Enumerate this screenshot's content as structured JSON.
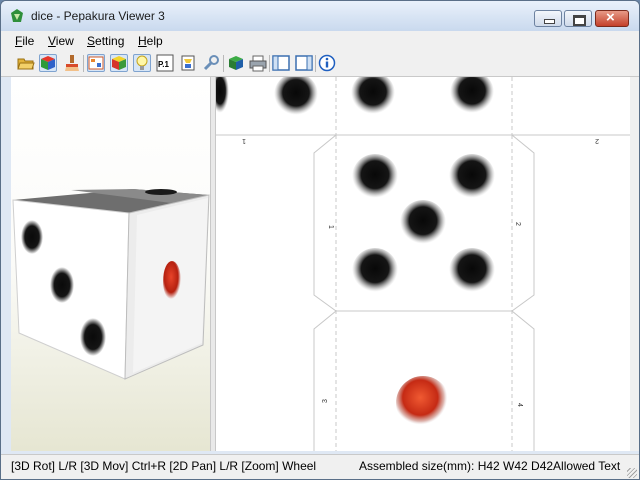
{
  "window": {
    "title": "dice - Pepakura Viewer 3"
  },
  "menu": {
    "file": {
      "mnemonic": "F",
      "rest": "ile"
    },
    "view": {
      "mnemonic": "V",
      "rest": "iew"
    },
    "setting": {
      "mnemonic": "S",
      "rest": "etting"
    },
    "help": {
      "mnemonic": "H",
      "rest": "elp"
    }
  },
  "toolbar": {
    "icons": [
      "open-folder-icon",
      "3d-cube-icon",
      "brush-icon",
      "unfold-icon",
      "color-cube-icon",
      "light-bulb-icon",
      "page-number-icon",
      "flap-icon",
      "wrench-icon",
      "assembly-icon",
      "print-icon",
      "single-pane-icon",
      "split-pane-icon",
      "info-icon"
    ],
    "page_label": "P.1"
  },
  "pattern": {
    "edge_labels": [
      "1",
      "2",
      "3",
      "4",
      "1",
      "2"
    ]
  },
  "colors": {
    "pip_dark": "#111111",
    "pip_red": "#c22a16",
    "background_3d": "#fbfbf8"
  },
  "status": {
    "controls": "[3D Rot] L/R [3D Mov] Ctrl+R [2D Pan] L/R [Zoom] Wheel",
    "size": "Assembled size(mm): H42 W42 D42Allowed Text"
  }
}
